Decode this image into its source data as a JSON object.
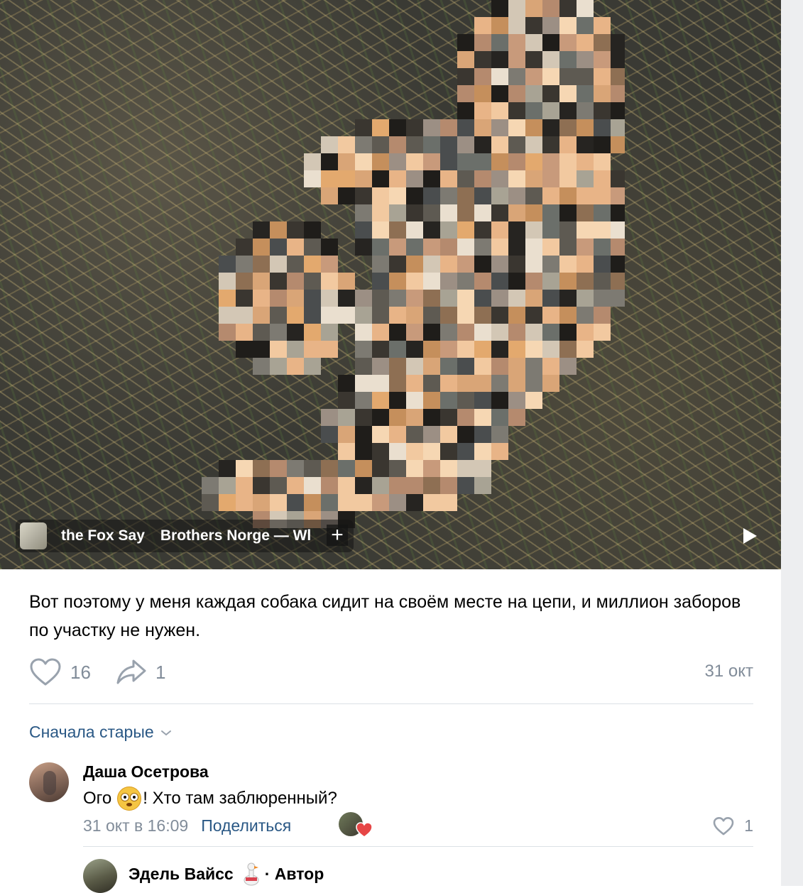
{
  "media": {
    "audio": {
      "track_part1": "the Fox Say",
      "track_part2": "Brothers Norge — Wl",
      "add_icon": "plus-icon",
      "cover_icon": "album-cover"
    },
    "play_icon": "play-icon"
  },
  "post": {
    "text": "Вот поэтому у меня каждая собака сидит на своём месте на цепи, и миллион заборов по участку не нужен.",
    "likes": "16",
    "shares": "1",
    "date": "31 окт"
  },
  "comments": {
    "sort_label": "Сначала старые",
    "items": [
      {
        "author": "Даша Осетрова",
        "text_before": "Ого",
        "emoji": "flushed-face-emoji",
        "text_after": "! Хто там заблюренный?",
        "time": "31 окт в 16:09",
        "share_label": "Поделиться",
        "likes": "1"
      }
    ],
    "reply": {
      "author": "Эдель Вайсс",
      "badge": "· Автор",
      "emoji": "goose-emoji"
    }
  },
  "colors": {
    "link": "#2a5885",
    "secondary": "#818c99",
    "divider": "#dce1e6",
    "heart_red": "#e64646"
  }
}
